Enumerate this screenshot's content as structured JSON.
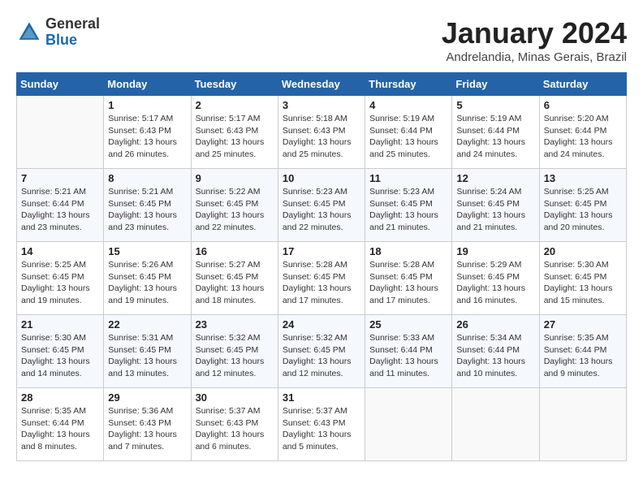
{
  "header": {
    "logo": {
      "general": "General",
      "blue": "Blue"
    },
    "title": "January 2024",
    "subtitle": "Andrelandia, Minas Gerais, Brazil"
  },
  "calendar": {
    "days_of_week": [
      "Sunday",
      "Monday",
      "Tuesday",
      "Wednesday",
      "Thursday",
      "Friday",
      "Saturday"
    ],
    "weeks": [
      [
        {
          "day": "",
          "info": ""
        },
        {
          "day": "1",
          "info": "Sunrise: 5:17 AM\nSunset: 6:43 PM\nDaylight: 13 hours\nand 26 minutes."
        },
        {
          "day": "2",
          "info": "Sunrise: 5:17 AM\nSunset: 6:43 PM\nDaylight: 13 hours\nand 25 minutes."
        },
        {
          "day": "3",
          "info": "Sunrise: 5:18 AM\nSunset: 6:43 PM\nDaylight: 13 hours\nand 25 minutes."
        },
        {
          "day": "4",
          "info": "Sunrise: 5:19 AM\nSunset: 6:44 PM\nDaylight: 13 hours\nand 25 minutes."
        },
        {
          "day": "5",
          "info": "Sunrise: 5:19 AM\nSunset: 6:44 PM\nDaylight: 13 hours\nand 24 minutes."
        },
        {
          "day": "6",
          "info": "Sunrise: 5:20 AM\nSunset: 6:44 PM\nDaylight: 13 hours\nand 24 minutes."
        }
      ],
      [
        {
          "day": "7",
          "info": "Sunrise: 5:21 AM\nSunset: 6:44 PM\nDaylight: 13 hours\nand 23 minutes."
        },
        {
          "day": "8",
          "info": "Sunrise: 5:21 AM\nSunset: 6:45 PM\nDaylight: 13 hours\nand 23 minutes."
        },
        {
          "day": "9",
          "info": "Sunrise: 5:22 AM\nSunset: 6:45 PM\nDaylight: 13 hours\nand 22 minutes."
        },
        {
          "day": "10",
          "info": "Sunrise: 5:23 AM\nSunset: 6:45 PM\nDaylight: 13 hours\nand 22 minutes."
        },
        {
          "day": "11",
          "info": "Sunrise: 5:23 AM\nSunset: 6:45 PM\nDaylight: 13 hours\nand 21 minutes."
        },
        {
          "day": "12",
          "info": "Sunrise: 5:24 AM\nSunset: 6:45 PM\nDaylight: 13 hours\nand 21 minutes."
        },
        {
          "day": "13",
          "info": "Sunrise: 5:25 AM\nSunset: 6:45 PM\nDaylight: 13 hours\nand 20 minutes."
        }
      ],
      [
        {
          "day": "14",
          "info": "Sunrise: 5:25 AM\nSunset: 6:45 PM\nDaylight: 13 hours\nand 19 minutes."
        },
        {
          "day": "15",
          "info": "Sunrise: 5:26 AM\nSunset: 6:45 PM\nDaylight: 13 hours\nand 19 minutes."
        },
        {
          "day": "16",
          "info": "Sunrise: 5:27 AM\nSunset: 6:45 PM\nDaylight: 13 hours\nand 18 minutes."
        },
        {
          "day": "17",
          "info": "Sunrise: 5:28 AM\nSunset: 6:45 PM\nDaylight: 13 hours\nand 17 minutes."
        },
        {
          "day": "18",
          "info": "Sunrise: 5:28 AM\nSunset: 6:45 PM\nDaylight: 13 hours\nand 17 minutes."
        },
        {
          "day": "19",
          "info": "Sunrise: 5:29 AM\nSunset: 6:45 PM\nDaylight: 13 hours\nand 16 minutes."
        },
        {
          "day": "20",
          "info": "Sunrise: 5:30 AM\nSunset: 6:45 PM\nDaylight: 13 hours\nand 15 minutes."
        }
      ],
      [
        {
          "day": "21",
          "info": "Sunrise: 5:30 AM\nSunset: 6:45 PM\nDaylight: 13 hours\nand 14 minutes."
        },
        {
          "day": "22",
          "info": "Sunrise: 5:31 AM\nSunset: 6:45 PM\nDaylight: 13 hours\nand 13 minutes."
        },
        {
          "day": "23",
          "info": "Sunrise: 5:32 AM\nSunset: 6:45 PM\nDaylight: 13 hours\nand 12 minutes."
        },
        {
          "day": "24",
          "info": "Sunrise: 5:32 AM\nSunset: 6:45 PM\nDaylight: 13 hours\nand 12 minutes."
        },
        {
          "day": "25",
          "info": "Sunrise: 5:33 AM\nSunset: 6:44 PM\nDaylight: 13 hours\nand 11 minutes."
        },
        {
          "day": "26",
          "info": "Sunrise: 5:34 AM\nSunset: 6:44 PM\nDaylight: 13 hours\nand 10 minutes."
        },
        {
          "day": "27",
          "info": "Sunrise: 5:35 AM\nSunset: 6:44 PM\nDaylight: 13 hours\nand 9 minutes."
        }
      ],
      [
        {
          "day": "28",
          "info": "Sunrise: 5:35 AM\nSunset: 6:44 PM\nDaylight: 13 hours\nand 8 minutes."
        },
        {
          "day": "29",
          "info": "Sunrise: 5:36 AM\nSunset: 6:43 PM\nDaylight: 13 hours\nand 7 minutes."
        },
        {
          "day": "30",
          "info": "Sunrise: 5:37 AM\nSunset: 6:43 PM\nDaylight: 13 hours\nand 6 minutes."
        },
        {
          "day": "31",
          "info": "Sunrise: 5:37 AM\nSunset: 6:43 PM\nDaylight: 13 hours\nand 5 minutes."
        },
        {
          "day": "",
          "info": ""
        },
        {
          "day": "",
          "info": ""
        },
        {
          "day": "",
          "info": ""
        }
      ]
    ]
  }
}
